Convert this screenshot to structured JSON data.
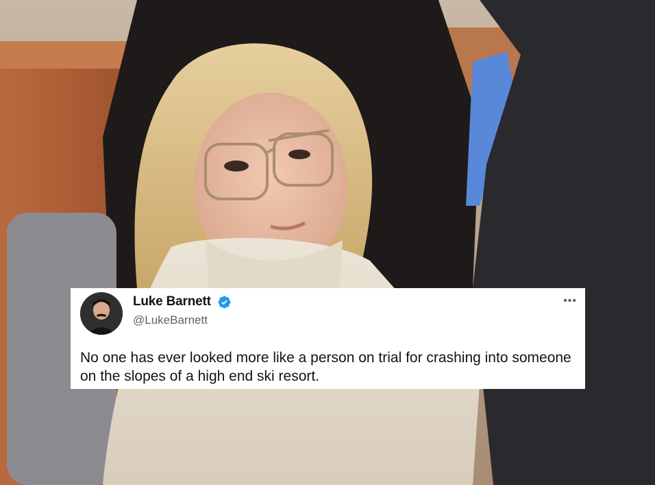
{
  "tweet": {
    "author": {
      "display_name": "Luke Barnett",
      "handle": "@LukeBarnett",
      "verified": true
    },
    "text": "No one has ever looked more like a person on trial for crashing into someone on the slopes of a high end ski resort.",
    "more_icon": "•••"
  },
  "icons": {
    "verified": "verified-badge-icon",
    "more": "more-options-icon"
  },
  "colors": {
    "verified_blue": "#1d9bf0",
    "card_background": "#ffffff",
    "text_primary": "#0f1419",
    "text_secondary": "#536471"
  }
}
